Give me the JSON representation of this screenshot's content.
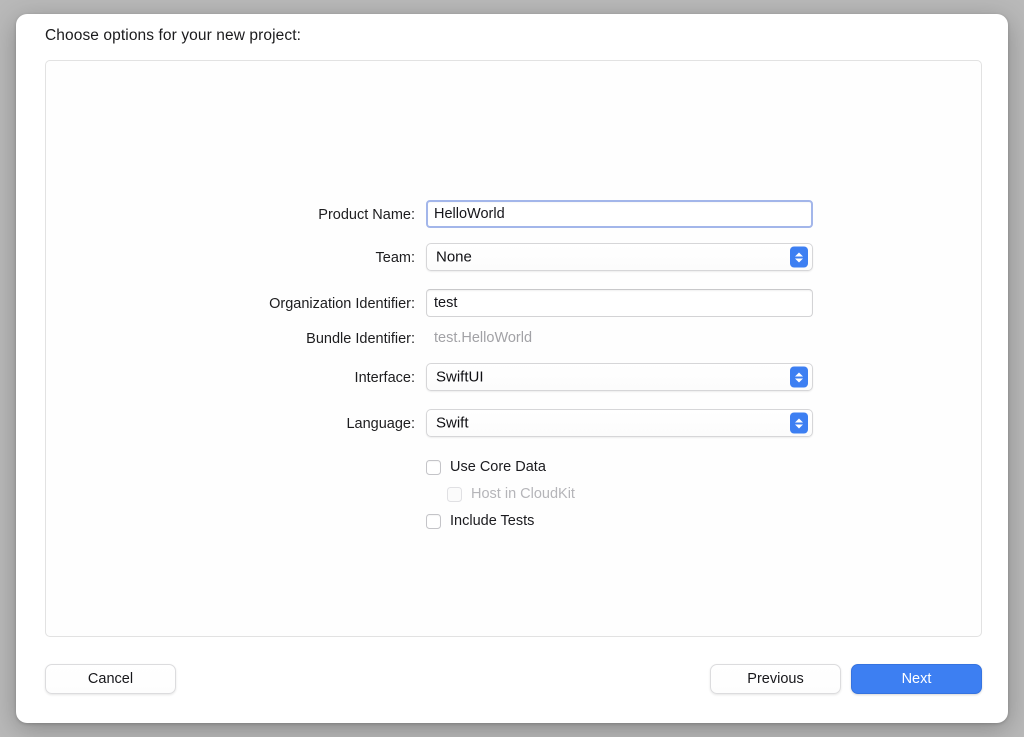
{
  "dialog": {
    "headline": "Choose options for your new project:"
  },
  "form": {
    "fields": [
      {
        "label": "Product Name:",
        "value": "HelloWorld",
        "type": "textfield",
        "focused": true
      },
      {
        "label": "Team:",
        "value": "None",
        "type": "popup"
      },
      {
        "label": "Organization Identifier:",
        "value": "test",
        "type": "textfield",
        "focused": false
      },
      {
        "label": "Bundle Identifier:",
        "value": "test.HelloWorld",
        "type": "static"
      },
      {
        "label": "Interface:",
        "value": "SwiftUI",
        "type": "popup"
      },
      {
        "label": "Language:",
        "value": "Swift",
        "type": "popup"
      }
    ],
    "checkboxes": [
      {
        "label": "Use Core Data",
        "checked": false,
        "disabled": false,
        "indented": false
      },
      {
        "label": "Host in CloudKit",
        "checked": false,
        "disabled": true,
        "indented": true
      },
      {
        "label": "Include Tests",
        "checked": false,
        "disabled": false,
        "indented": false
      }
    ]
  },
  "footer": {
    "cancel_label": "Cancel",
    "previous_label": "Previous",
    "next_label": "Next"
  },
  "colors": {
    "accent": "#3d7ff2",
    "focus_ring": "#a3b6ea",
    "disabled_text": "#b5b5b9",
    "static_text": "#a2a2a6",
    "backdrop": "#b9b9b9"
  }
}
